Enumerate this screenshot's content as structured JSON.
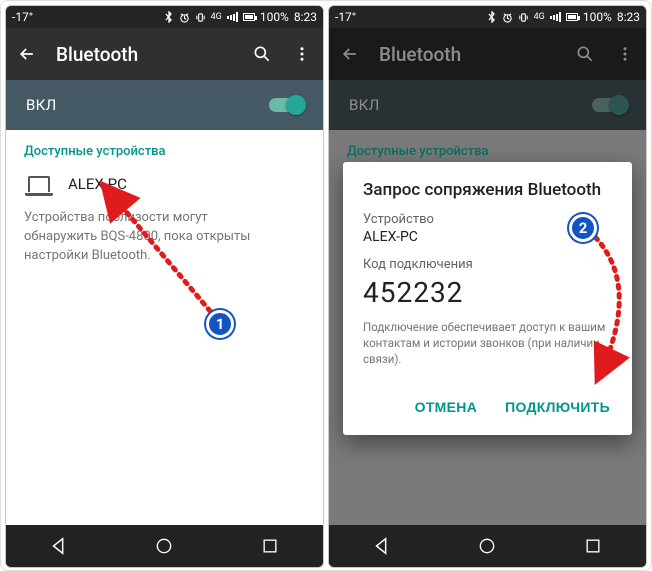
{
  "status": {
    "temp": "-17°",
    "net_label": "4G",
    "battery": "100%",
    "time": "8:23"
  },
  "appbar": {
    "title": "Bluetooth"
  },
  "toggle": {
    "label": "ВКЛ"
  },
  "section_header": "Доступные устройства",
  "device": {
    "name": "ALEX-PC"
  },
  "helper": "Устройства поблизости могут обнаружить BQS-4800, пока открыты настройки Bluetooth.",
  "dialog": {
    "title": "Запрос сопряжения Bluetooth",
    "device_label": "Устройство",
    "device_name": "ALEX-PC",
    "code_label": "Код подключения",
    "code": "452232",
    "help": "Подключение обеспечивает доступ к вашим контактам и истории звонков (при наличии связи).",
    "cancel": "ОТМЕНА",
    "ok": "ПОДКЛЮЧИТЬ"
  },
  "badges": {
    "one": "1",
    "two": "2"
  }
}
